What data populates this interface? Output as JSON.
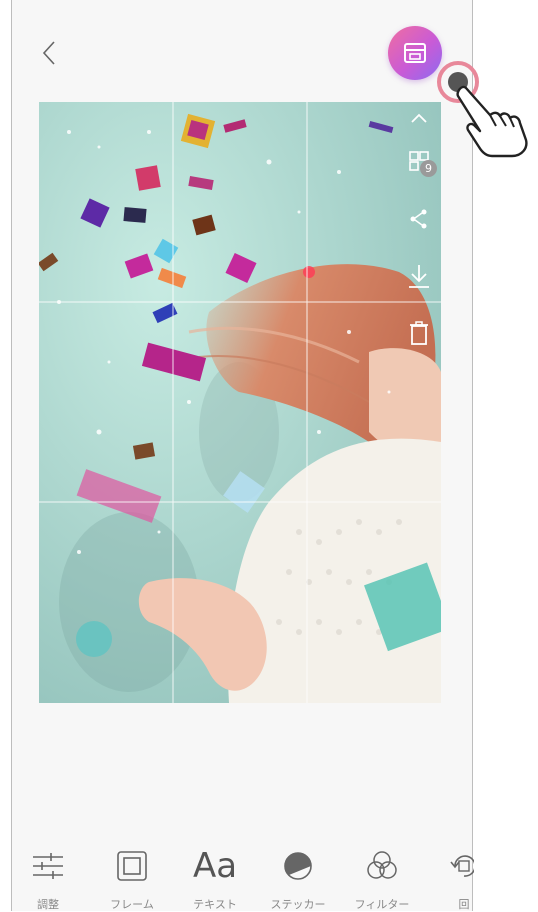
{
  "header": {
    "back_icon": "chevron-left-icon",
    "print_icon": "print-icon",
    "accent": "#d060c8"
  },
  "side_tools": [
    {
      "name": "collapse",
      "icon": "chevron-up-icon"
    },
    {
      "name": "split-print",
      "icon": "grid-split-icon",
      "badge": "9"
    },
    {
      "name": "share",
      "icon": "share-icon"
    },
    {
      "name": "save",
      "icon": "download-icon"
    },
    {
      "name": "delete",
      "icon": "trash-icon"
    }
  ],
  "photo": {
    "description_icon": "confetti-photo"
  },
  "bottom_tools": [
    {
      "label": "調整",
      "icon": "sliders-icon"
    },
    {
      "label": "フレーム",
      "icon": "frame-icon"
    },
    {
      "label": "テキスト",
      "icon": "text-aa-icon",
      "glyph": "Aa"
    },
    {
      "label": "ステッカー",
      "icon": "sticker-icon"
    },
    {
      "label": "フィルター",
      "icon": "filter-icon"
    },
    {
      "label": "回",
      "icon": "rotate-icon"
    }
  ]
}
